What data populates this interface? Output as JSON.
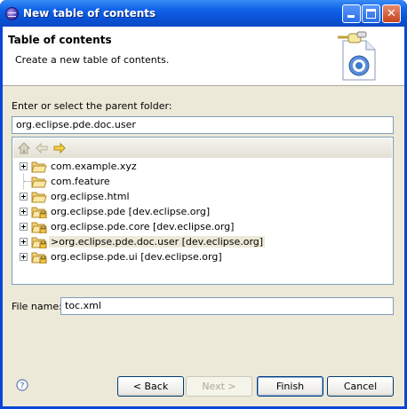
{
  "window": {
    "title": "New table of contents"
  },
  "banner": {
    "title": "Table of contents",
    "description": "Create a new table of contents."
  },
  "parent": {
    "label": "Enter or select the parent folder:",
    "value": "org.eclipse.pde.doc.user"
  },
  "tree": {
    "items": [
      {
        "label": "com.example.xyz",
        "expandable": true,
        "overlay": false,
        "selected": false
      },
      {
        "label": "com.feature",
        "expandable": false,
        "overlay": false,
        "selected": false
      },
      {
        "label": "org.eclipse.html",
        "expandable": true,
        "overlay": false,
        "selected": false
      },
      {
        "label": "org.eclipse.pde   [dev.eclipse.org]",
        "expandable": true,
        "overlay": true,
        "selected": false
      },
      {
        "label": "org.eclipse.pde.core   [dev.eclipse.org]",
        "expandable": true,
        "overlay": true,
        "selected": false
      },
      {
        "label": ">org.eclipse.pde.doc.user   [dev.eclipse.org]",
        "expandable": true,
        "overlay": true,
        "selected": true
      },
      {
        "label": "org.eclipse.pde.ui   [dev.eclipse.org]",
        "expandable": true,
        "overlay": true,
        "selected": false
      }
    ]
  },
  "file": {
    "label": "File name:",
    "value": "toc.xml"
  },
  "buttons": {
    "back": "< Back",
    "next": "Next >",
    "finish": "Finish",
    "cancel": "Cancel"
  },
  "icons": {
    "help": "help-icon",
    "home": "home-icon",
    "back": "back-arrow-icon",
    "forward": "forward-arrow-icon",
    "folder": "folder-icon",
    "banner": "toc-wizard-icon"
  }
}
